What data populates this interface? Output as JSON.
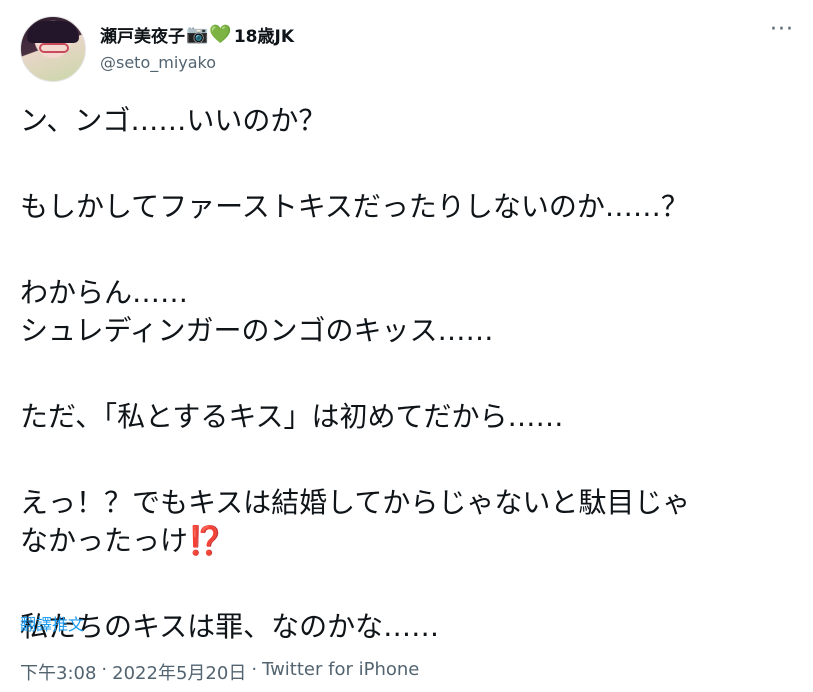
{
  "author": {
    "display_name": "瀬戸美夜子",
    "camera_emoji": "📷",
    "heart_emoji": "💚",
    "badge_text": "18歳JK",
    "handle": "@seto_miyako"
  },
  "more_icon": "more-horizontal-icon",
  "tweet": {
    "paragraphs": [
      [
        "ン、ンゴ……いいのか？"
      ],
      [
        "もしかしてファーストキスだったりしないのか……？"
      ],
      [
        "わからん……",
        "シュレディンガーのンゴのキッス……"
      ],
      [
        "ただ、「私とするキス」は初めてだから……"
      ],
      [
        "えっ！？でもキスは結婚してからじゃないと駄目じゃ",
        "なかったっけ"
      ],
      [
        "私たちのキスは罪、なのかな……"
      ]
    ],
    "interrobang_emoji": "⁉️"
  },
  "translate_label": "翻譯推文",
  "meta": {
    "time": "下午3:08",
    "date": "2022年5月20日",
    "source": "Twitter for iPhone",
    "separator": "·"
  },
  "colors": {
    "text": "#0f1419",
    "secondary": "#536471",
    "link": "#1d9bf0",
    "heart": "#5fbf4a",
    "interrobang": "#c5213a"
  }
}
